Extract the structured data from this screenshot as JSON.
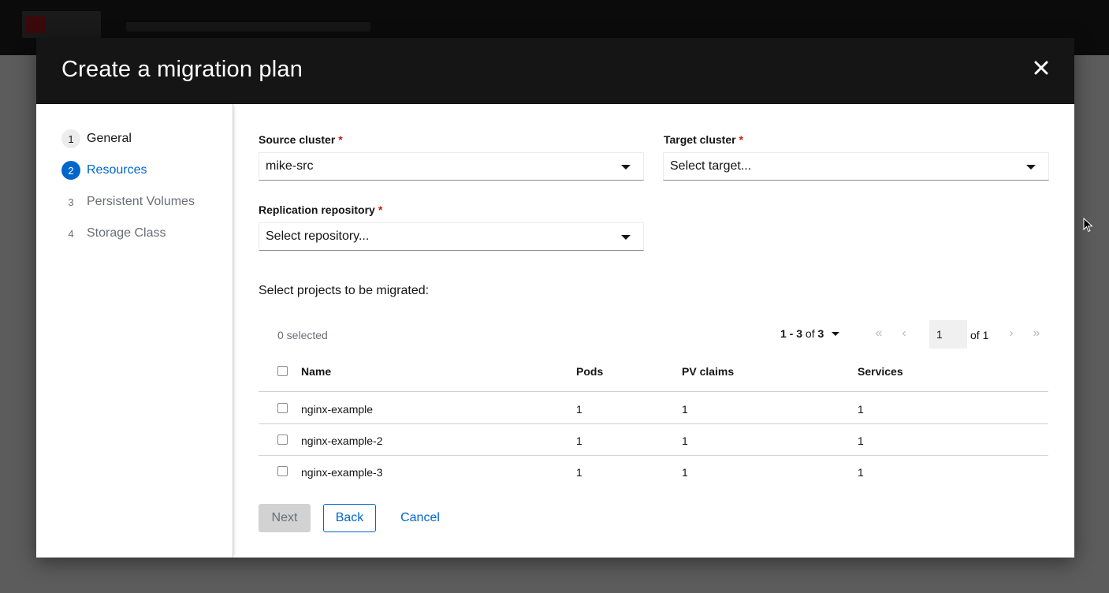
{
  "modal": {
    "title": "Create a migration plan"
  },
  "wizard_nav": [
    {
      "num": "1",
      "label": "General",
      "state": "done"
    },
    {
      "num": "2",
      "label": "Resources",
      "state": "current"
    },
    {
      "num": "3",
      "label": "Persistent Volumes",
      "state": "future"
    },
    {
      "num": "4",
      "label": "Storage Class",
      "state": "future"
    }
  ],
  "form": {
    "source_cluster": {
      "label": "Source cluster",
      "required_mark": "*",
      "value": "mike-src"
    },
    "target_cluster": {
      "label": "Target cluster",
      "required_mark": "*",
      "value": "Select target..."
    },
    "replication_repository": {
      "label": "Replication repository",
      "required_mark": "*",
      "value": "Select repository..."
    },
    "projects_prompt": "Select projects to be migrated:"
  },
  "toolbar": {
    "selected_text": "0 selected",
    "range_start_end": "1 - 3",
    "range_of": "of",
    "range_total": "3",
    "page_value": "1",
    "page_of": "of 1",
    "first_icon": "«",
    "prev_icon": "‹",
    "next_icon": "›",
    "last_icon": "»"
  },
  "table": {
    "headers": {
      "name": "Name",
      "pods": "Pods",
      "pv_claims": "PV claims",
      "services": "Services"
    },
    "rows": [
      {
        "name": "nginx-example",
        "pods": "1",
        "pv_claims": "1",
        "services": "1"
      },
      {
        "name": "nginx-example-2",
        "pods": "1",
        "pv_claims": "1",
        "services": "1"
      },
      {
        "name": "nginx-example-3",
        "pods": "1",
        "pv_claims": "1",
        "services": "1"
      }
    ]
  },
  "footer": {
    "next_label": "Next",
    "back_label": "Back",
    "cancel_label": "Cancel"
  },
  "colors": {
    "accent": "#0066cc",
    "header_bg": "#151515",
    "required": "#c9190b",
    "disabled_bg": "#d2d2d2"
  }
}
